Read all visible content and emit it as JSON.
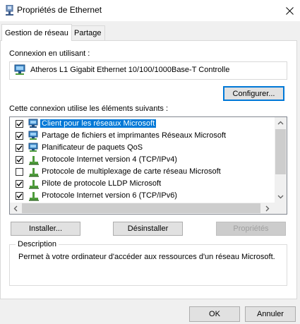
{
  "window": {
    "title": "Propriétés de Ethernet",
    "icon": "network-adapter-icon",
    "close_icon": "close-icon"
  },
  "tabs": [
    {
      "label": "Gestion de réseau",
      "active": true
    },
    {
      "label": "Partage",
      "active": false
    }
  ],
  "connection": {
    "label": "Connexion en utilisant :",
    "adapter_name": "Atheros L1 Gigabit Ethernet 10/100/1000Base-T Controlle",
    "configure_button": "Configurer..."
  },
  "items_section": {
    "label": "Cette connexion utilise les éléments suivants :",
    "items": [
      {
        "label": "Client pour les réseaux Microsoft",
        "checked": true,
        "icon": "network-client-icon",
        "selected": true
      },
      {
        "label": "Partage de fichiers et imprimantes Réseaux Microsoft",
        "checked": true,
        "icon": "network-service-icon",
        "selected": false
      },
      {
        "label": "Planificateur de paquets QoS",
        "checked": true,
        "icon": "network-service-icon",
        "selected": false
      },
      {
        "label": "Protocole Internet version 4 (TCP/IPv4)",
        "checked": true,
        "icon": "protocol-icon",
        "selected": false
      },
      {
        "label": "Protocole de multiplexage de carte réseau Microsoft",
        "checked": false,
        "icon": "protocol-icon",
        "selected": false
      },
      {
        "label": "Pilote de protocole LLDP Microsoft",
        "checked": true,
        "icon": "protocol-icon",
        "selected": false
      },
      {
        "label": "Protocole Internet version 6 (TCP/IPv6)",
        "checked": true,
        "icon": "protocol-icon",
        "selected": false
      }
    ]
  },
  "actions": {
    "install": "Installer...",
    "uninstall": "Désinstaller",
    "properties": "Propriétés"
  },
  "description": {
    "legend": "Description",
    "text": "Permet à votre ordinateur d'accéder aux ressources d'un réseau Microsoft."
  },
  "footer": {
    "ok": "OK",
    "cancel": "Annuler"
  },
  "colors": {
    "selection": "#0078d7",
    "focus_border": "#0078d7",
    "button_face": "#e1e1e1",
    "window_bg": "#f0f0f0"
  }
}
